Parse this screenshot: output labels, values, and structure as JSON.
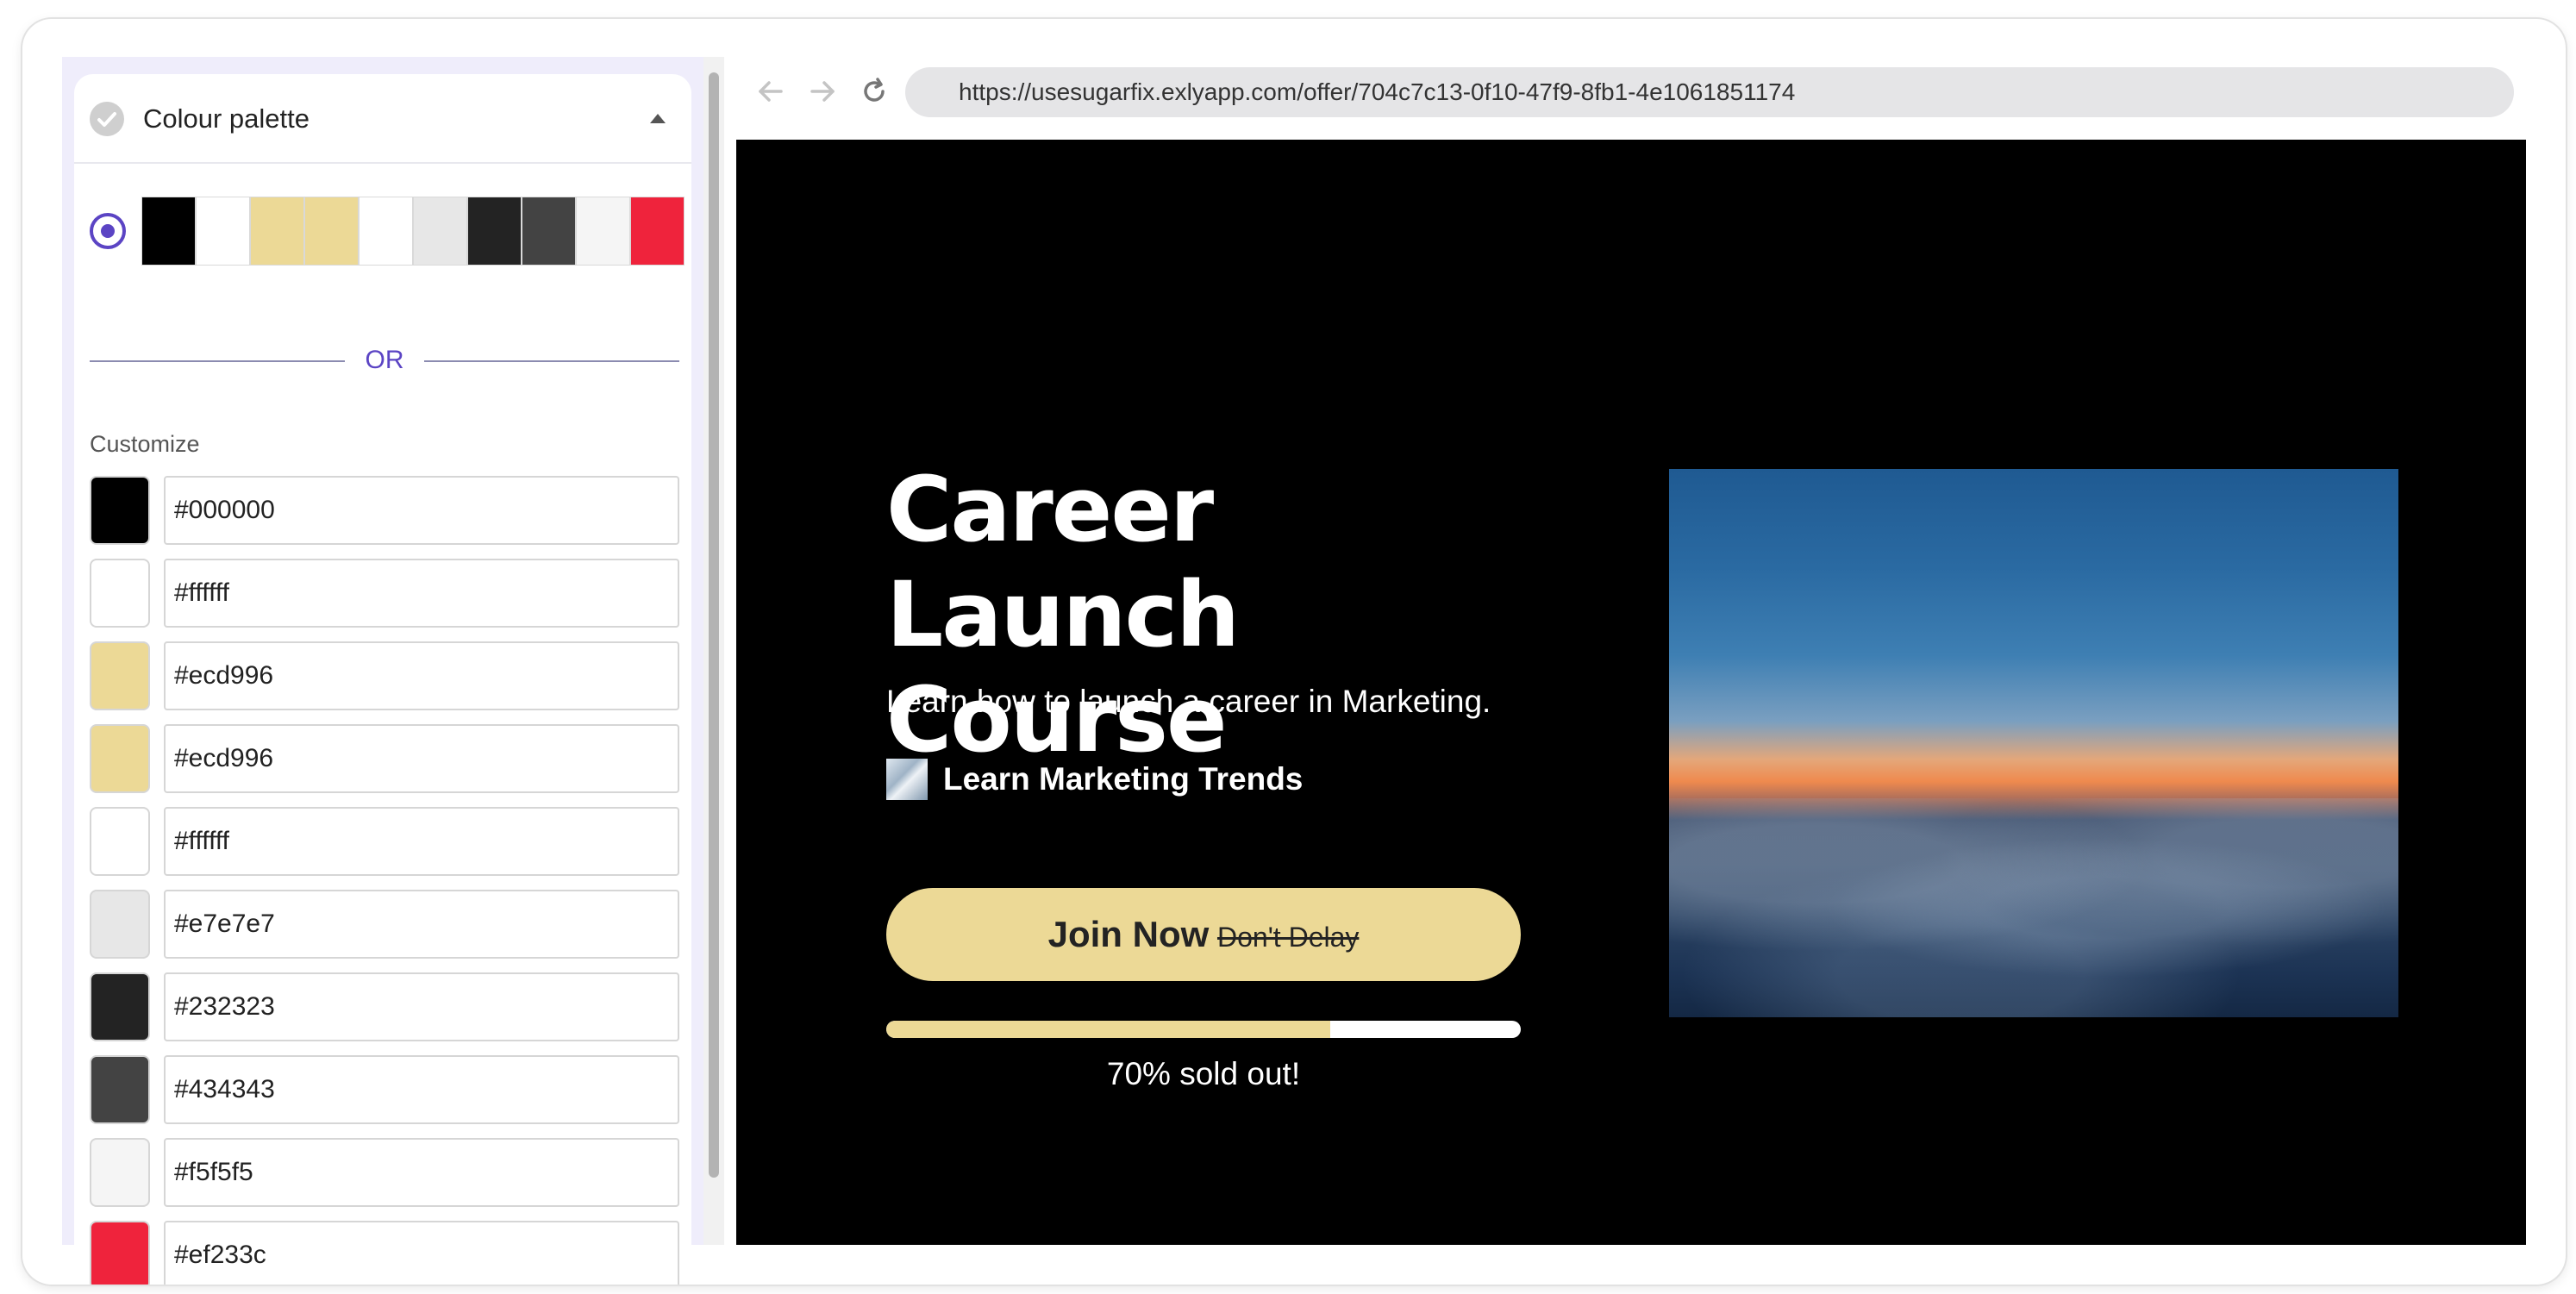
{
  "palette_panel": {
    "title": "Colour palette",
    "swatches": [
      "#000000",
      "#ffffff",
      "#ecd996",
      "#ecd996",
      "#ffffff",
      "#e7e7e7",
      "#232323",
      "#434343",
      "#f5f5f5",
      "#ef233c"
    ],
    "or_label": "OR",
    "customize_label": "Customize",
    "colors": [
      {
        "value": "#000000"
      },
      {
        "value": "#ffffff"
      },
      {
        "value": "#ecd996"
      },
      {
        "value": "#ecd996"
      },
      {
        "value": "#ffffff"
      },
      {
        "value": "#e7e7e7"
      },
      {
        "value": "#232323"
      },
      {
        "value": "#434343"
      },
      {
        "value": "#f5f5f5"
      },
      {
        "value": "#ef233c"
      }
    ],
    "accent_color": "#5b44c4"
  },
  "browser": {
    "url": "https://usesugarfix.exlyapp.com/offer/704c7c13-0f10-47f9-8fb1-4e1061851174",
    "icons": [
      "back-arrow-icon",
      "forward-arrow-icon",
      "reload-icon"
    ]
  },
  "preview": {
    "background": "#000000",
    "title": "Career Launch Course",
    "subtitle": "Learn how to launch a career in Marketing.",
    "creator_name": "Learn Marketing Trends",
    "cta_label": "Join Now",
    "cta_strike_label": "Don't Delay",
    "cta_color": "#ecd996",
    "progress_fraction": 0.7,
    "progress_label": "70% sold out!"
  }
}
